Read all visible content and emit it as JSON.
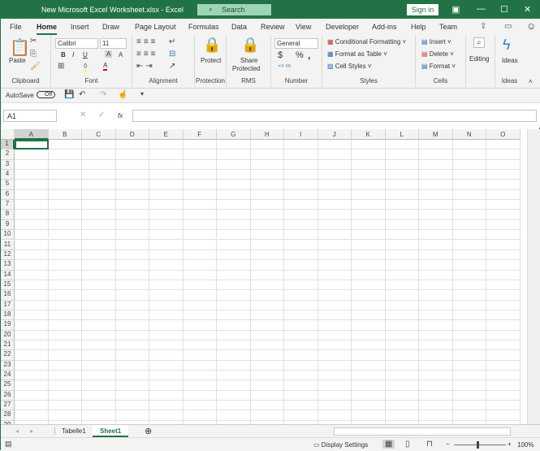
{
  "title": "New Microsoft Excel Worksheet.xlsx  -  Excel",
  "search_placeholder": "Search",
  "sign_in": "Sign in",
  "tabs": [
    "File",
    "Home",
    "Insert",
    "Draw",
    "Page Layout",
    "Formulas",
    "Data",
    "Review",
    "View",
    "Developer",
    "Add-ins",
    "Help",
    "Team"
  ],
  "active_tab": "Home",
  "ribbon": {
    "clipboard": {
      "paste": "Paste",
      "label": "Clipboard"
    },
    "font": {
      "name": "Calibri",
      "size": "11",
      "bold": "B",
      "italic": "I",
      "underline": "U",
      "grow": "A",
      "shrink": "A",
      "color": "A",
      "label": "Font"
    },
    "alignment": {
      "label": "Alignment"
    },
    "protection": {
      "protect": "Protect",
      "label": "Protection"
    },
    "rms": {
      "share": "Share",
      "protected": "Protected",
      "label": "RMS"
    },
    "number": {
      "format": "General",
      "currency": "$",
      "percent": "%",
      "comma": ",",
      "label": "Number"
    },
    "styles": {
      "conditional": "Conditional Formatting",
      "table": "Format as Table",
      "cell_styles": "Cell Styles",
      "label": "Styles"
    },
    "cells": {
      "insert": "Insert",
      "delete": "Delete",
      "format": "Format",
      "label": "Cells"
    },
    "editing": {
      "label": "Editing"
    },
    "ideas": {
      "button": "Ideas",
      "label": "Ideas"
    }
  },
  "qat": {
    "autosave": "AutoSave",
    "toggle": "Off"
  },
  "name_box": "A1",
  "fx": "fx",
  "columns": [
    "A",
    "B",
    "C",
    "D",
    "E",
    "F",
    "G",
    "H",
    "I",
    "J",
    "K",
    "L",
    "M",
    "N",
    "O"
  ],
  "row_count": 29,
  "sheets": [
    "Tabelle1",
    "Sheet1"
  ],
  "active_sheet": "Sheet1",
  "status": {
    "display_settings": "Display Settings",
    "zoom": "100%"
  },
  "colors": {
    "brand": "#217346"
  }
}
